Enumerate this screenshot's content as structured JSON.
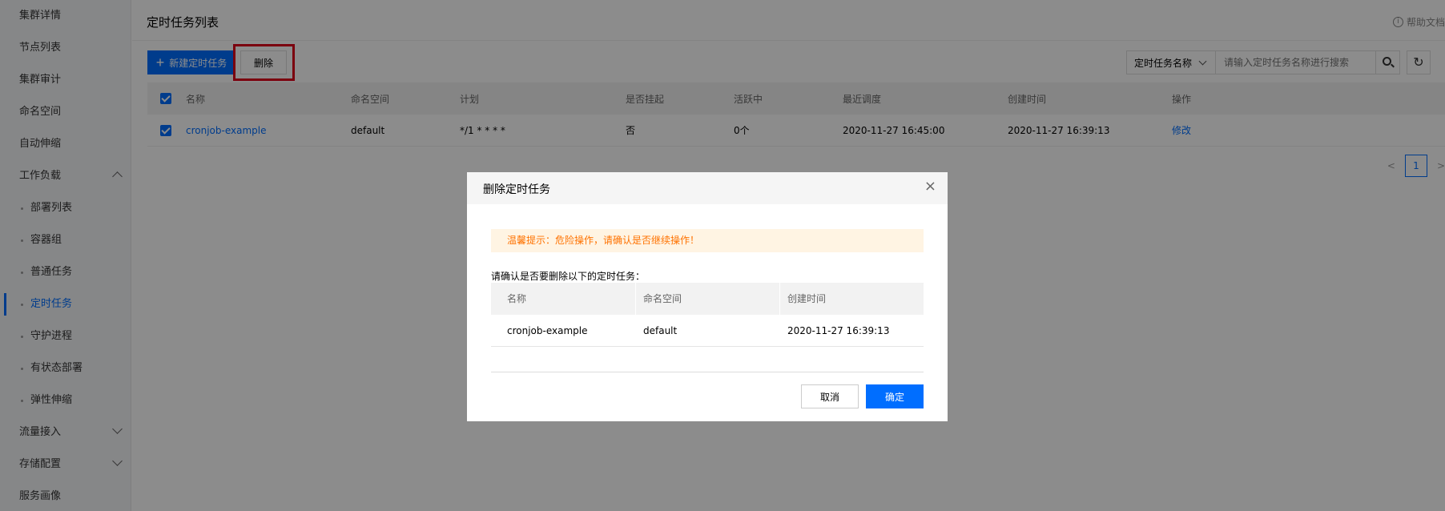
{
  "sidebar": {
    "items": [
      {
        "label": "集群详情"
      },
      {
        "label": "节点列表"
      },
      {
        "label": "集群审计"
      },
      {
        "label": "命名空间"
      },
      {
        "label": "自动伸缩"
      },
      {
        "label": "工作负载"
      },
      {
        "label": "部署列表"
      },
      {
        "label": "容器组"
      },
      {
        "label": "普通任务"
      },
      {
        "label": "定时任务"
      },
      {
        "label": "守护进程"
      },
      {
        "label": "有状态部署"
      },
      {
        "label": "弹性伸缩"
      },
      {
        "label": "流量接入"
      },
      {
        "label": "存储配置"
      },
      {
        "label": "服务画像"
      }
    ]
  },
  "header": {
    "title": "定时任务列表",
    "help": "帮助文档",
    "help_icon": "i"
  },
  "toolbar": {
    "new_label": "新建定时任务",
    "new_icon": "+",
    "delete_label": "删除",
    "search_select": "定时任务名称",
    "search_placeholder": "请输入定时任务名称进行搜索",
    "refresh_icon": "↻"
  },
  "table": {
    "columns": [
      "名称",
      "命名空间",
      "计划",
      "是否挂起",
      "活跃中",
      "最近调度",
      "创建时间",
      "操作"
    ],
    "rows": [
      {
        "name": "cronjob-example",
        "namespace": "default",
        "schedule": "*/1 * * * *",
        "suspended": "否",
        "active": "0个",
        "last_schedule": "2020-11-27 16:45:00",
        "created": "2020-11-27 16:39:13",
        "action": "修改"
      }
    ]
  },
  "pagination": {
    "prev": "<",
    "page": "1",
    "next": ">"
  },
  "dialog": {
    "title": "删除定时任务",
    "close": "×",
    "warning": "温馨提示：危险操作，请确认是否继续操作！",
    "confirm_text": "请确认是否要删除以下的定时任务：",
    "columns": [
      "名称",
      "命名空间",
      "创建时间"
    ],
    "row": {
      "name": "cronjob-example",
      "namespace": "default",
      "created": "2020-11-27 16:39:13"
    },
    "cancel": "取消",
    "ok": "确定"
  },
  "colors": {
    "accent": "#006eff",
    "highlight": "#e0001b",
    "warning": "#ff7200"
  }
}
